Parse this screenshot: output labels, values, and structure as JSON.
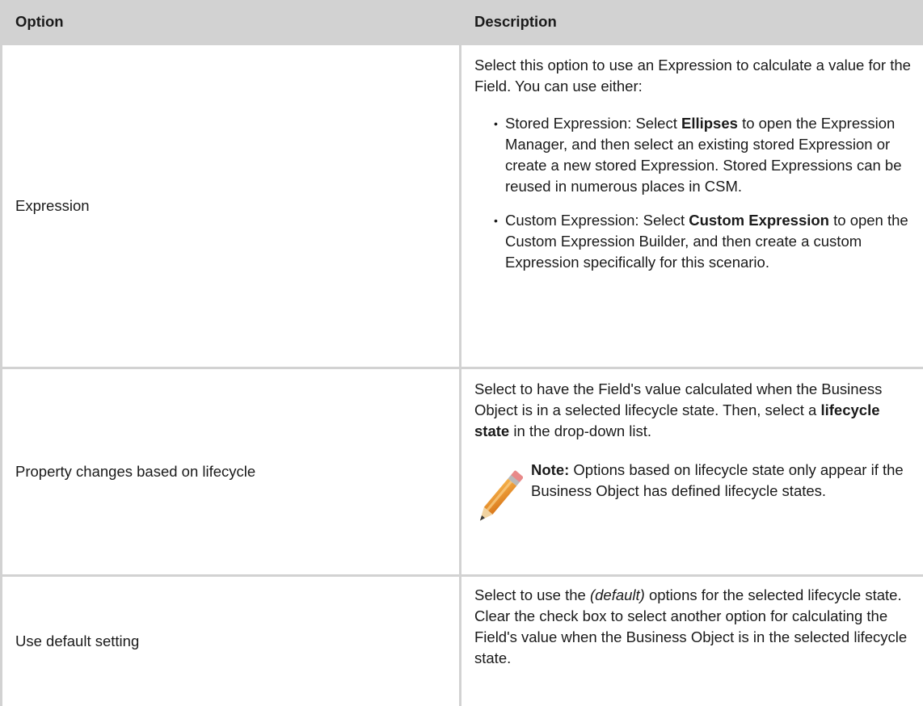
{
  "table": {
    "headers": {
      "option": "Option",
      "description": "Description"
    },
    "rows": [
      {
        "option": "Expression",
        "intro": "Select this option to use an Expression to calculate a value for the Field. You can use either:",
        "bullets": [
          {
            "lead": "Stored Expression: Select ",
            "bold": "Ellipses",
            "rest": " to open the Expression Manager, and then select an existing stored Expression or create a new stored Expression. Stored Expressions can be reused in numerous places in CSM."
          },
          {
            "lead": "Custom Expression: Select ",
            "bold": "Custom Expression",
            "rest": " to open the Custom Expression Builder, and then create a custom Expression specifically for this scenario."
          }
        ]
      },
      {
        "option": "Property changes based on lifecycle",
        "intro_lead": "Select to have the Field's value calculated when the Business Object is in a selected lifecycle state. Then, select a ",
        "intro_bold": "lifecycle state",
        "intro_rest": " in the drop-down list.",
        "note_label": "Note:",
        "note_text": " Options based on lifecycle state only appear if the Business Object has defined lifecycle states.",
        "note_icon": "pencil-icon"
      },
      {
        "option": "Use default setting",
        "desc_lead": "Select to use the ",
        "desc_italic": "(default)",
        "desc_rest": " options for the selected lifecycle state. Clear the check box to select another option for calculating the Field's value when the Business Object is in the selected lifecycle state."
      }
    ]
  },
  "colors": {
    "header_bg": "#d2d2d2",
    "border": "#d2d2d2",
    "text": "#1a1a1a"
  }
}
